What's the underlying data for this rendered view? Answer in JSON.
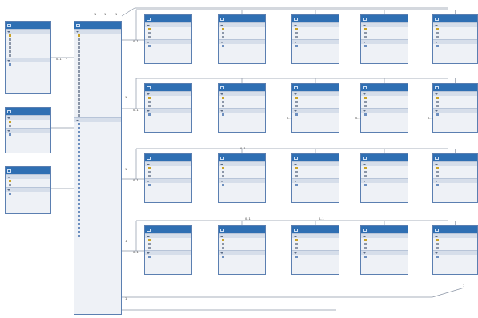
{
  "colors": {
    "header": "#2f6fb3",
    "body": "#eef1f6",
    "border": "#5b7fb1",
    "line": "#8c96a6"
  },
  "sections": {
    "properties": "",
    "navigation": ""
  },
  "entities": [
    {
      "id": "e-left-1",
      "title": "",
      "props": [
        "",
        "",
        "",
        "",
        "",
        ""
      ],
      "nav": [
        ""
      ]
    },
    {
      "id": "e-left-2",
      "title": "",
      "props": [
        "",
        ""
      ],
      "nav": [
        ""
      ]
    },
    {
      "id": "e-left-3",
      "title": "",
      "props": [
        "",
        ""
      ],
      "nav": [
        ""
      ]
    },
    {
      "id": "e-center",
      "title": "",
      "props": [
        "",
        "",
        "",
        "",
        "",
        "",
        "",
        "",
        "",
        "",
        "",
        "",
        "",
        "",
        "",
        "",
        "",
        "",
        "",
        "",
        ""
      ],
      "nav": [
        "",
        "",
        "",
        "",
        "",
        "",
        "",
        "",
        "",
        "",
        "",
        "",
        "",
        "",
        "",
        "",
        "",
        "",
        "",
        "",
        "",
        "",
        "",
        "",
        "",
        "",
        "",
        "",
        ""
      ]
    },
    {
      "id": "r1c1",
      "title": "",
      "props": [
        "",
        "",
        ""
      ],
      "nav": [
        ""
      ]
    },
    {
      "id": "r1c2",
      "title": "",
      "props": [
        "",
        "",
        ""
      ],
      "nav": [
        ""
      ]
    },
    {
      "id": "r1c3",
      "title": "",
      "props": [
        "",
        "",
        ""
      ],
      "nav": [
        ""
      ]
    },
    {
      "id": "r1c4",
      "title": "",
      "props": [
        "",
        "",
        ""
      ],
      "nav": [
        ""
      ]
    },
    {
      "id": "r1c5",
      "title": "",
      "props": [
        "",
        "",
        ""
      ],
      "nav": [
        ""
      ]
    },
    {
      "id": "r2c1",
      "title": "",
      "props": [
        "",
        "",
        ""
      ],
      "nav": [
        ""
      ]
    },
    {
      "id": "r2c2",
      "title": "",
      "props": [
        "",
        "",
        ""
      ],
      "nav": [
        ""
      ]
    },
    {
      "id": "r2c3",
      "title": "",
      "props": [
        "",
        "",
        ""
      ],
      "nav": [
        ""
      ]
    },
    {
      "id": "r2c4",
      "title": "",
      "props": [
        "",
        "",
        ""
      ],
      "nav": [
        ""
      ]
    },
    {
      "id": "r2c5",
      "title": "",
      "props": [
        "",
        "",
        ""
      ],
      "nav": [
        ""
      ]
    },
    {
      "id": "r3c1",
      "title": "",
      "props": [
        "",
        "",
        ""
      ],
      "nav": [
        ""
      ]
    },
    {
      "id": "r3c2",
      "title": "",
      "props": [
        "",
        "",
        ""
      ],
      "nav": [
        ""
      ]
    },
    {
      "id": "r3c3",
      "title": "",
      "props": [
        "",
        "",
        ""
      ],
      "nav": [
        ""
      ]
    },
    {
      "id": "r3c4",
      "title": "",
      "props": [
        "",
        "",
        ""
      ],
      "nav": [
        ""
      ]
    },
    {
      "id": "r3c5",
      "title": "",
      "props": [
        "",
        "",
        ""
      ],
      "nav": [
        ""
      ]
    },
    {
      "id": "r4c1",
      "title": "",
      "props": [
        "",
        "",
        ""
      ],
      "nav": [
        ""
      ]
    },
    {
      "id": "r4c2",
      "title": "",
      "props": [
        "",
        "",
        ""
      ],
      "nav": [
        ""
      ]
    },
    {
      "id": "r4c3",
      "title": "",
      "props": [
        "",
        "",
        ""
      ],
      "nav": [
        ""
      ]
    },
    {
      "id": "r4c4",
      "title": "",
      "props": [
        "",
        "",
        ""
      ],
      "nav": [
        ""
      ]
    },
    {
      "id": "r4c5",
      "title": "",
      "props": [
        "",
        "",
        ""
      ],
      "nav": [
        ""
      ]
    }
  ],
  "multiplicities": [
    {
      "id": "m1",
      "text": "1"
    },
    {
      "id": "m2",
      "text": "1"
    },
    {
      "id": "m3",
      "text": "1"
    },
    {
      "id": "m4",
      "text": "0..1"
    },
    {
      "id": "m5",
      "text": "*"
    },
    {
      "id": "m6",
      "text": "0..1"
    },
    {
      "id": "m7",
      "text": "0..1"
    },
    {
      "id": "m8",
      "text": "0..1"
    },
    {
      "id": "m9",
      "text": "0..1"
    },
    {
      "id": "m10",
      "text": "0..1"
    },
    {
      "id": "m11",
      "text": "0..1"
    },
    {
      "id": "m12",
      "text": "0..1"
    },
    {
      "id": "m13",
      "text": "0..1"
    },
    {
      "id": "m14",
      "text": "0..1"
    },
    {
      "id": "m15",
      "text": "0..1"
    },
    {
      "id": "m16",
      "text": "1"
    },
    {
      "id": "m17",
      "text": "1"
    },
    {
      "id": "m18",
      "text": "1"
    },
    {
      "id": "m19",
      "text": "1"
    },
    {
      "id": "m20",
      "text": "1"
    }
  ]
}
